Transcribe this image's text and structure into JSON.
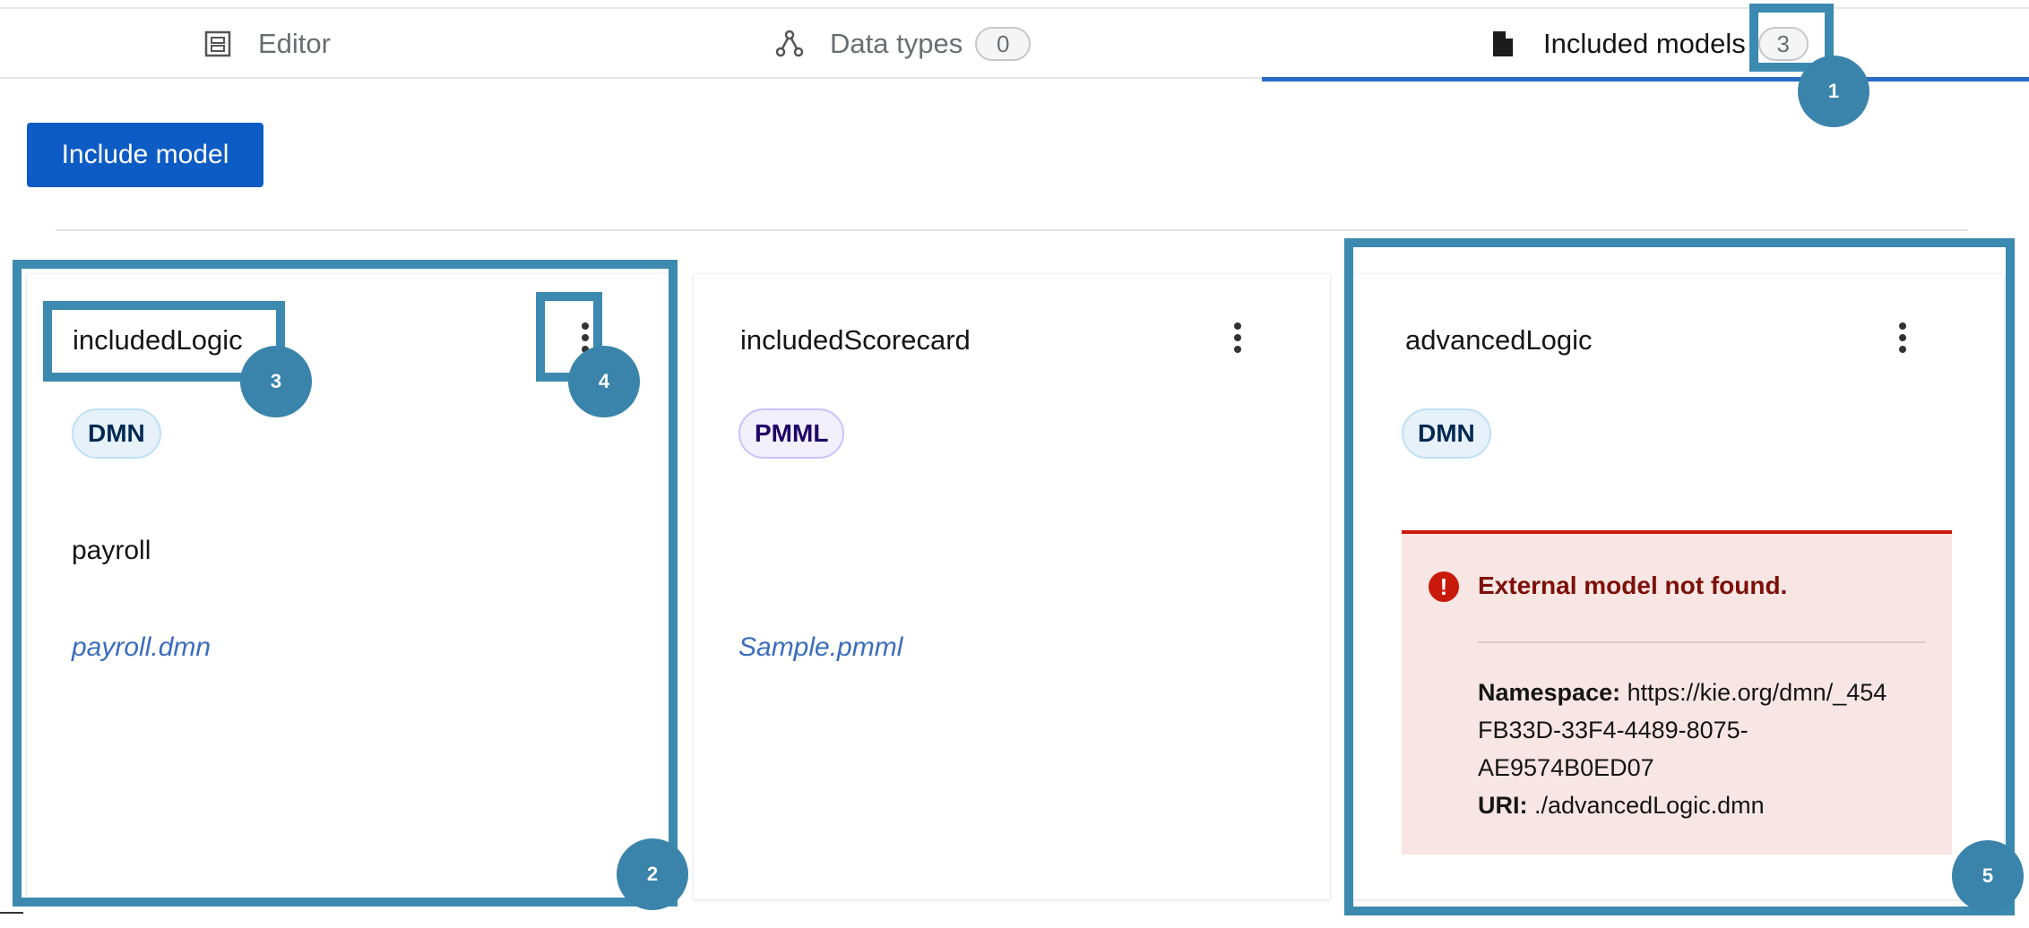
{
  "tabs": [
    {
      "label": "Editor",
      "icon": "editor-icon",
      "count": null
    },
    {
      "label": "Data types",
      "icon": "data-types-icon",
      "count": "0"
    },
    {
      "label": "Included models",
      "icon": "file-icon",
      "count": "3",
      "active": true
    }
  ],
  "toolbar": {
    "include_label": "Include model"
  },
  "cards": [
    {
      "title": "includedLogic",
      "badge": "DMN",
      "namespace": "payroll",
      "file": "payroll.dmn"
    },
    {
      "title": "includedScorecard",
      "badge": "PMML",
      "file": "Sample.pmml"
    },
    {
      "title": "advancedLogic",
      "badge": "DMN",
      "error": {
        "title": "External model not found.",
        "namespace_label": "Namespace:",
        "namespace_value_1": " https://kie.org/dmn/_454",
        "namespace_value_2": "FB33D-33F4-4489-8075-",
        "namespace_value_3": "AE9574B0ED07",
        "uri_label": "URI:",
        "uri_value": " ./advancedLogic.dmn"
      }
    }
  ],
  "callouts": [
    "1",
    "2",
    "3",
    "4",
    "5"
  ],
  "colors": {
    "accent": "#0d5bc4",
    "callout": "#3a84ab",
    "danger": "#c9190b"
  }
}
